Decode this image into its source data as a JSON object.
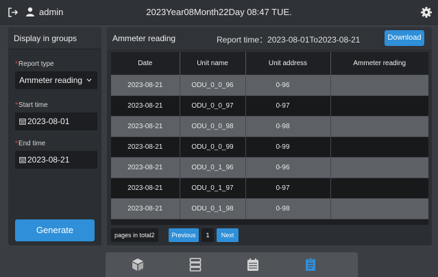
{
  "header": {
    "user": "admin",
    "datetime": "2023Year08Month22Day 08:47 TUE."
  },
  "sidebar": {
    "title": "Display in groups",
    "report_type_label": "Report type",
    "report_type_value": "Ammeter reading",
    "start_label": "Start time",
    "start_value": "2023-08-01",
    "end_label": "End time",
    "end_value": "2023-08-21",
    "generate_label": "Generate"
  },
  "main": {
    "title": "Ammeter reading",
    "report_time": "Report time：2023-08-01To2023-08-21",
    "download_label": "Download",
    "columns": [
      "Date",
      "Unit name",
      "Unit address",
      "Ammeter reading"
    ],
    "rows": [
      [
        "2023-08-21",
        "ODU_0_0_96",
        "0-96",
        ""
      ],
      [
        "2023-08-21",
        "ODU_0_0_97",
        "0-97",
        ""
      ],
      [
        "2023-08-21",
        "ODU_0_0_98",
        "0-98",
        ""
      ],
      [
        "2023-08-21",
        "ODU_0_0_99",
        "0-99",
        ""
      ],
      [
        "2023-08-21",
        "ODU_0_1_96",
        "0-96",
        ""
      ],
      [
        "2023-08-21",
        "ODU_0_1_97",
        "0-97",
        ""
      ],
      [
        "2023-08-21",
        "ODU_0_1_98",
        "0-98",
        ""
      ]
    ]
  },
  "pager": {
    "total_label": "pages in total2",
    "prev_label": "Previous",
    "page": "1",
    "next_label": "Next"
  },
  "dock": {
    "items": [
      "cube-icon",
      "server-list-icon",
      "calendar-icon",
      "report-icon"
    ],
    "active": "report-icon"
  },
  "colors": {
    "accent": "#2f8fd8",
    "required": "#e0494a"
  }
}
